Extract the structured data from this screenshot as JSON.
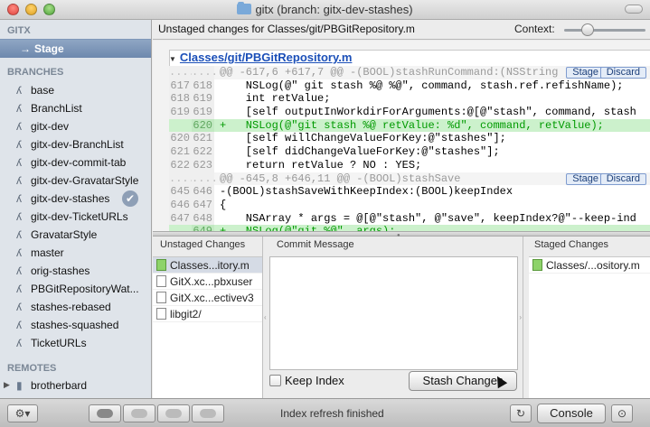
{
  "window": {
    "title": "gitx (branch: gitx-dev-stashes)"
  },
  "sidebar": {
    "app_heading": "GITX",
    "stage_label": "Stage",
    "branches_heading": "BRANCHES",
    "branches": [
      "base",
      "BranchList",
      "gitx-dev",
      "gitx-dev-BranchList",
      "gitx-dev-commit-tab",
      "gitx-dev-GravatarStyle",
      "gitx-dev-stashes",
      "gitx-dev-TicketURLs",
      "GravatarStyle",
      "master",
      "orig-stashes",
      "PBGitRepositoryWat...",
      "stashes-rebased",
      "stashes-squashed",
      "TicketURLs"
    ],
    "current_branch_badge": "✔",
    "remotes_heading": "REMOTES",
    "remotes": [
      "brotherbard"
    ]
  },
  "header": {
    "title": "Unstaged changes for Classes/git/PBGitRepository.m",
    "context_label": "Context:"
  },
  "diff": {
    "file": "Classes/git/PBGitRepository.m",
    "stage_label": "Stage",
    "discard_label": "Discard",
    "lines": [
      {
        "type": "hunk",
        "old": "....",
        "new": "....",
        "text": "@@ -617,6 +617,7 @@ -(BOOL)stashRunCommand:(NSString"
      },
      {
        "type": "ctx",
        "old": "617",
        "new": "618",
        "text": "    NSLog(@\" git stash %@ %@\", command, stash.ref.refishName);"
      },
      {
        "type": "ctx",
        "old": "618",
        "new": "619",
        "text": "    int retValue;"
      },
      {
        "type": "ctx",
        "old": "619",
        "new": "619",
        "text": "    [self outputInWorkdirForArguments:@[@\"stash\", command, stash"
      },
      {
        "type": "add",
        "old": "",
        "new": "620",
        "text": "+   NSLog(@\"git stash %@ retValue: %d\", command, retValue);"
      },
      {
        "type": "ctx",
        "old": "620",
        "new": "621",
        "text": "    [self willChangeValueForKey:@\"stashes\"];"
      },
      {
        "type": "ctx",
        "old": "621",
        "new": "622",
        "text": "    [self didChangeValueForKey:@\"stashes\"];"
      },
      {
        "type": "ctx",
        "old": "622",
        "new": "623",
        "text": "    return retValue ? NO : YES;"
      },
      {
        "type": "hunk",
        "old": "....",
        "new": "....",
        "text": "@@ -645,8 +646,11 @@ -(BOOL)stashSave"
      },
      {
        "type": "ctx",
        "old": "645",
        "new": "646",
        "text": "-(BOOL)stashSaveWithKeepIndex:(BOOL)keepIndex"
      },
      {
        "type": "ctx",
        "old": "646",
        "new": "647",
        "text": "{"
      },
      {
        "type": "ctx",
        "old": "647",
        "new": "648",
        "text": "    NSArray * args = @[@\"stash\", @\"save\", keepIndex?@\"--keep-ind"
      },
      {
        "type": "add",
        "old": "",
        "new": "649",
        "text": "+   NSLog(@\"git %@\", args);"
      }
    ]
  },
  "unstaged": {
    "title": "Unstaged Changes",
    "files": [
      {
        "name": "Classes...itory.m",
        "icon": "modified-file-icon"
      },
      {
        "name": "GitX.xc...pbxuser",
        "icon": "untracked-file-icon"
      },
      {
        "name": "GitX.xc...ectivev3",
        "icon": "untracked-file-icon"
      },
      {
        "name": "libgit2/",
        "icon": "untracked-file-icon"
      }
    ]
  },
  "commit": {
    "title": "Commit Message",
    "keep_index_label": "Keep Index",
    "stash_button_label": "Stash Changes"
  },
  "staged": {
    "title": "Staged Changes",
    "files": [
      {
        "name": "Classes/...ository.m",
        "icon": "modified-file-icon"
      }
    ]
  },
  "bottombar": {
    "status": "Index refresh finished",
    "console_label": "Console"
  }
}
